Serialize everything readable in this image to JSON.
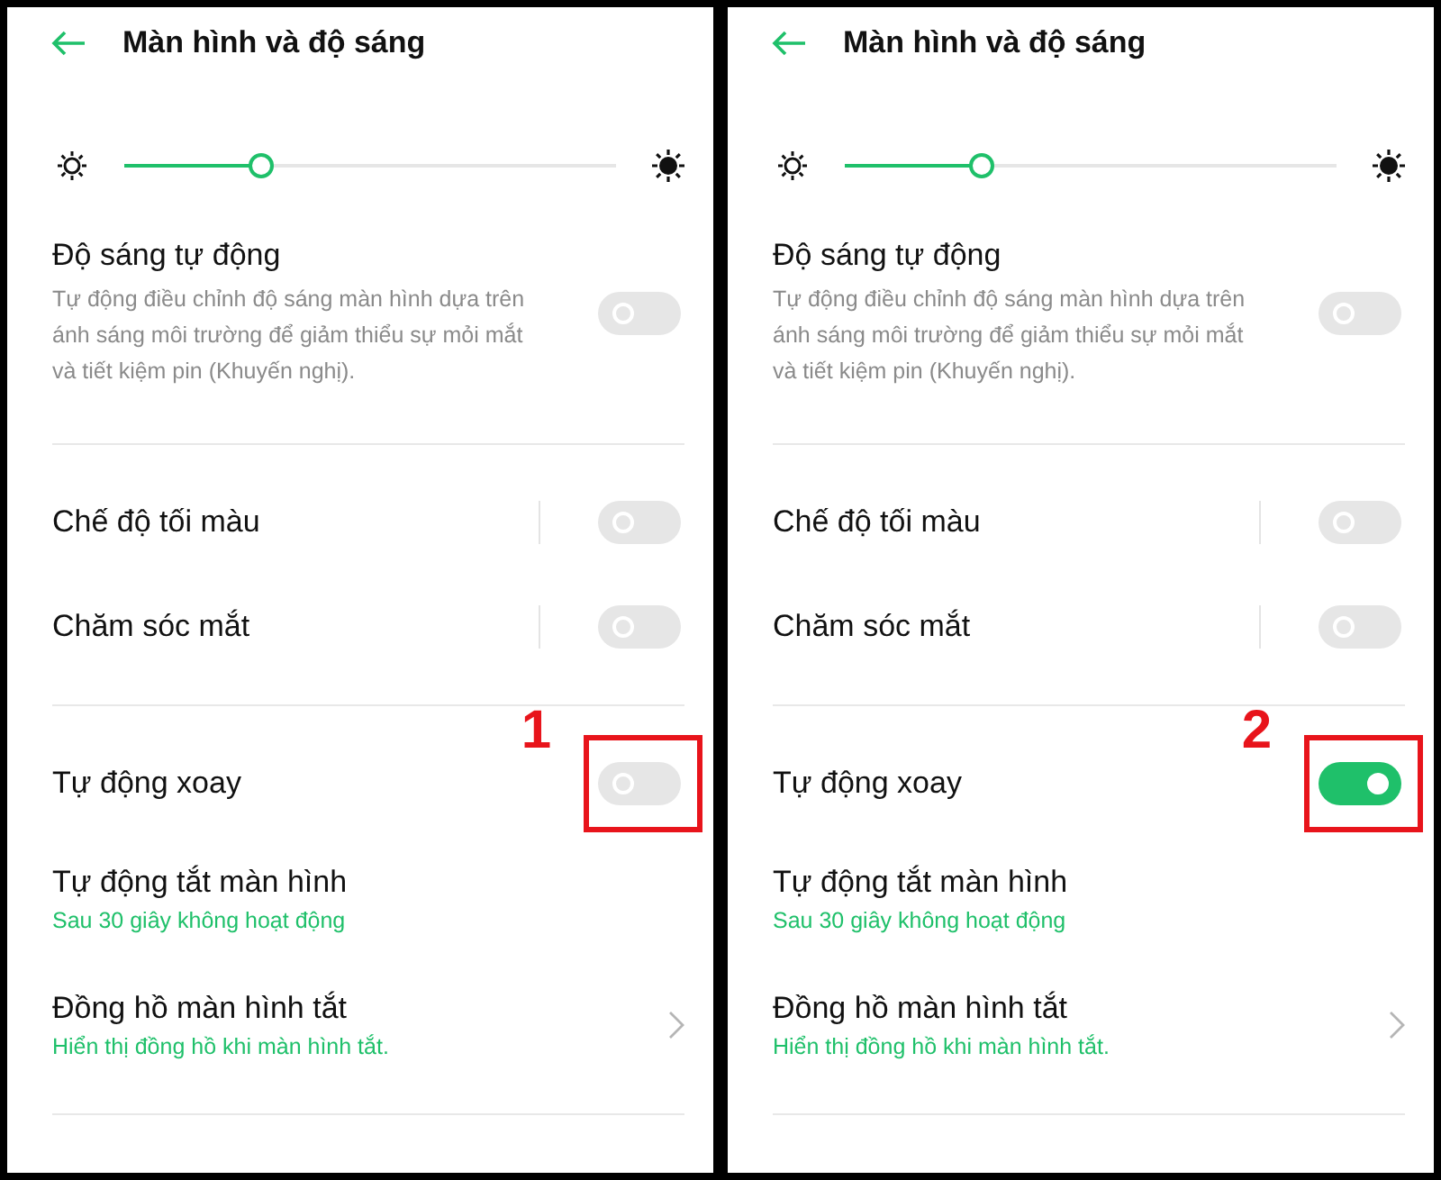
{
  "panels": [
    {
      "title": "Màn hình và độ sáng",
      "brightness": {
        "level": 0.28
      },
      "sections": [
        [
          {
            "kind": "toggle",
            "label": "Độ sáng tự động",
            "description": "Tự động điều chỉnh độ sáng màn hình dựa trên ánh sáng môi trường để giảm thiểu sự mỏi mắt và tiết kiệm pin (Khuyến nghị).",
            "on": false,
            "separator": false
          }
        ],
        [
          {
            "kind": "toggle",
            "label": "Chế độ tối màu",
            "on": false,
            "separator": true
          },
          {
            "kind": "toggle",
            "label": "Chăm sóc mắt",
            "on": false,
            "separator": true
          }
        ],
        [
          {
            "kind": "toggle",
            "label": "Tự động xoay",
            "on": false,
            "separator": false,
            "highlight": "1"
          },
          {
            "kind": "nav",
            "label": "Tự động tắt màn hình",
            "summary": "Sau 30 giây không hoạt động",
            "chevron": false
          },
          {
            "kind": "nav",
            "label": "Đồng hồ màn hình tắt",
            "summary": "Hiển thị đồng hồ khi màn hình tắt.",
            "chevron": true
          }
        ]
      ]
    },
    {
      "title": "Màn hình và độ sáng",
      "brightness": {
        "level": 0.28
      },
      "sections": [
        [
          {
            "kind": "toggle",
            "label": "Độ sáng tự động",
            "description": "Tự động điều chỉnh độ sáng màn hình dựa trên ánh sáng môi trường để giảm thiểu sự mỏi mắt và tiết kiệm pin (Khuyến nghị).",
            "on": false,
            "separator": false
          }
        ],
        [
          {
            "kind": "toggle",
            "label": "Chế độ tối màu",
            "on": false,
            "separator": true
          },
          {
            "kind": "toggle",
            "label": "Chăm sóc mắt",
            "on": false,
            "separator": true
          }
        ],
        [
          {
            "kind": "toggle",
            "label": "Tự động xoay",
            "on": true,
            "separator": false,
            "highlight": "2"
          },
          {
            "kind": "nav",
            "label": "Tự động tắt màn hình",
            "summary": "Sau 30 giây không hoạt động",
            "chevron": false
          },
          {
            "kind": "nav",
            "label": "Đồng hồ màn hình tắt",
            "summary": "Hiển thị đồng hồ khi màn hình tắt.",
            "chevron": true
          }
        ]
      ]
    }
  ]
}
